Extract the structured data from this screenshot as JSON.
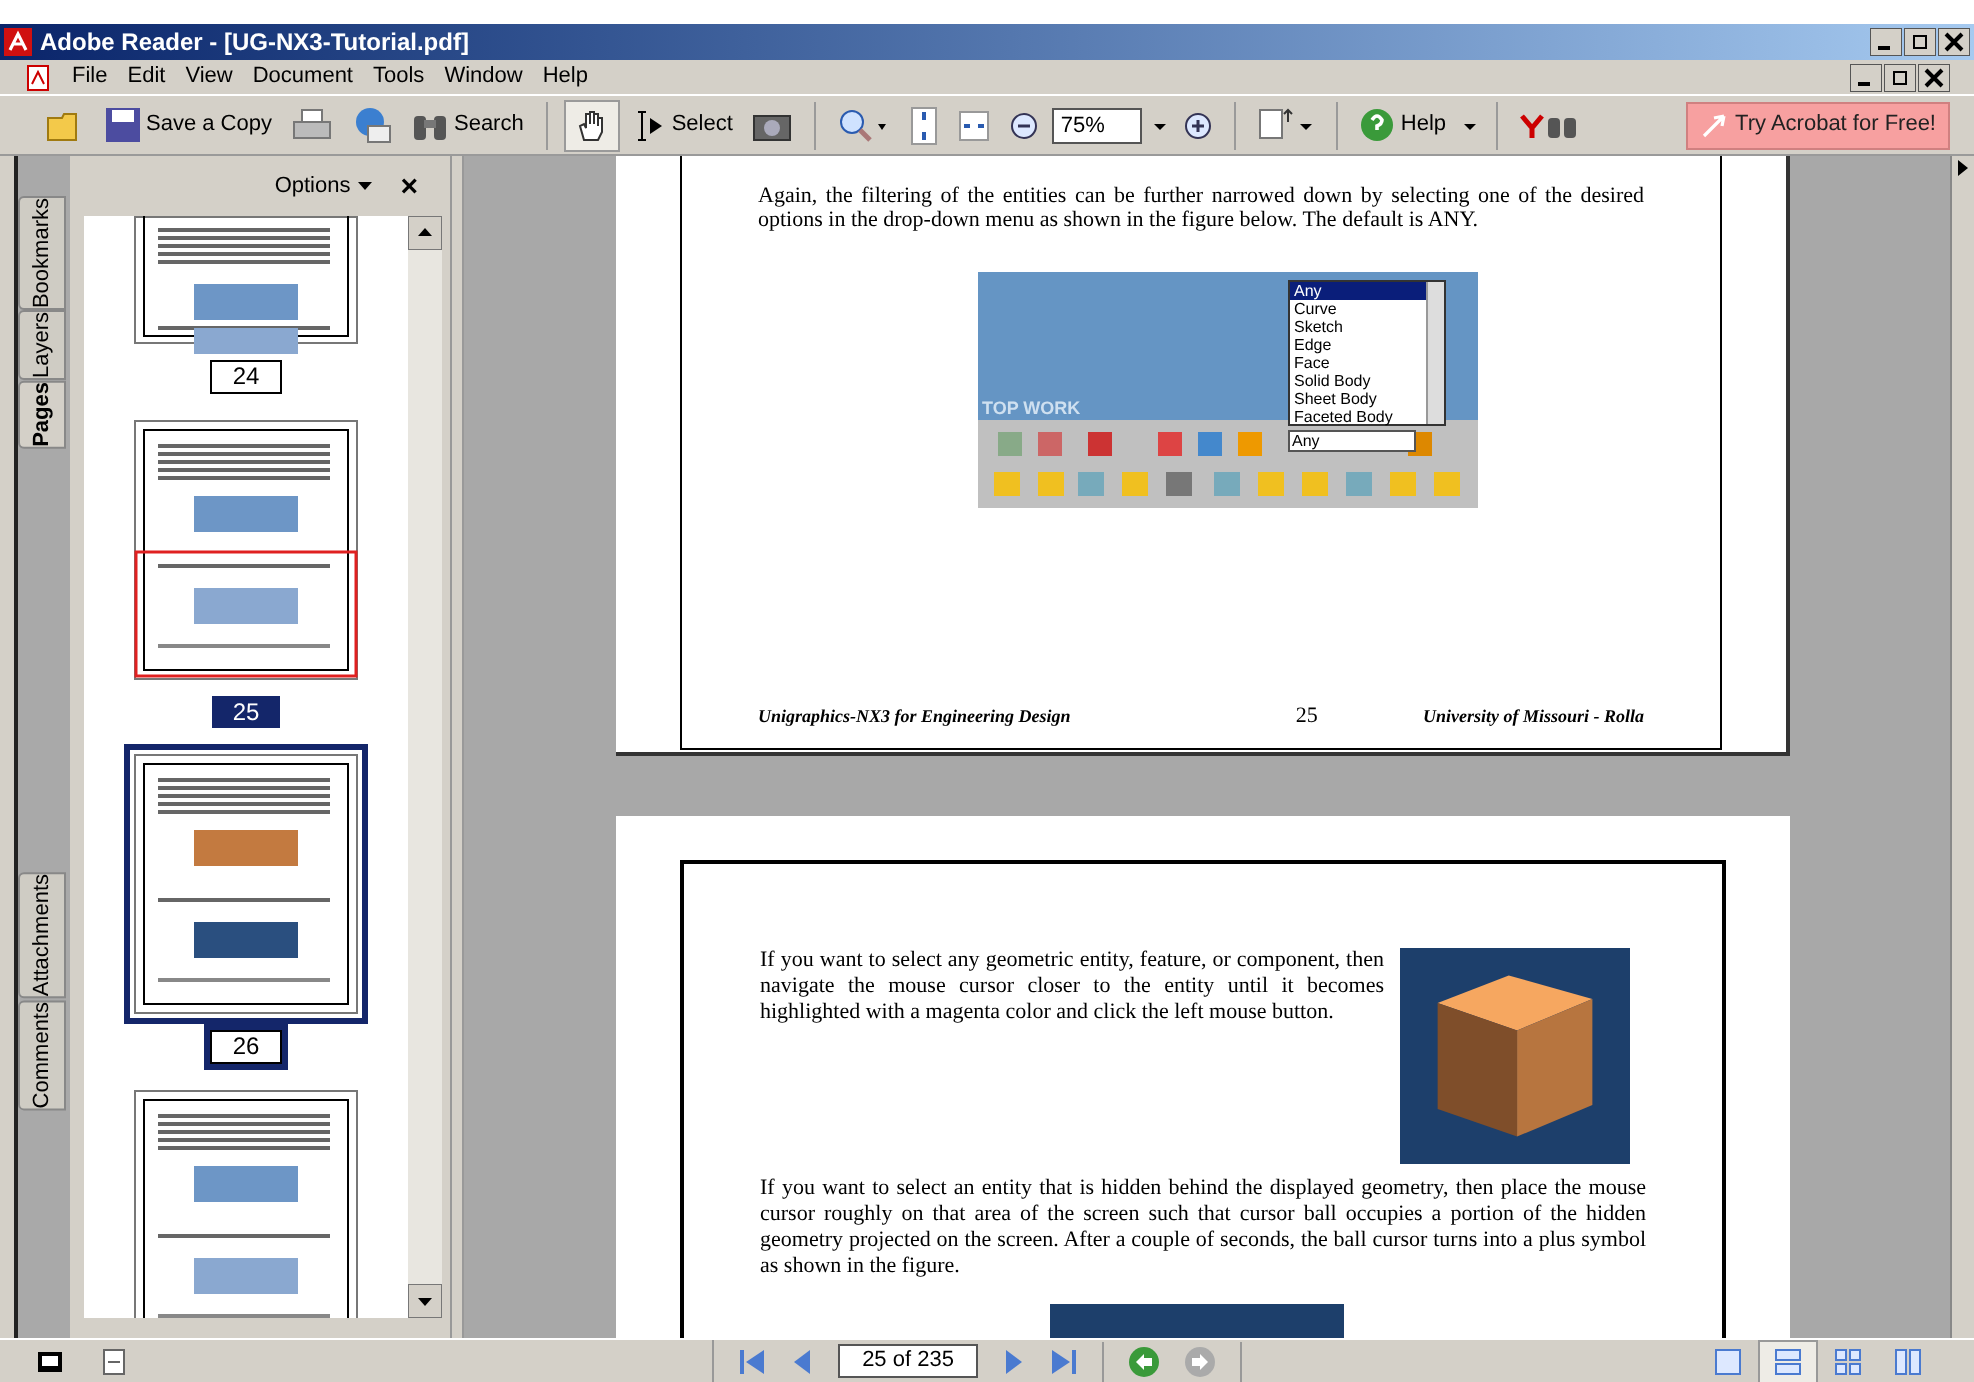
{
  "window": {
    "title": "Adobe Reader - [UG-NX3-Tutorial.pdf]"
  },
  "menu": [
    "File",
    "Edit",
    "View",
    "Document",
    "Tools",
    "Window",
    "Help"
  ],
  "toolbar": {
    "save_copy": "Save a Copy",
    "search": "Search",
    "select": "Select",
    "zoom": "75%",
    "help": "Help",
    "promo": "Try Acrobat for Free!"
  },
  "side_tabs": [
    {
      "label": "Bookmarks",
      "selected": false
    },
    {
      "label": "Layers",
      "selected": false
    },
    {
      "label": "Pages",
      "selected": true
    },
    {
      "label": "Attachments",
      "selected": false
    },
    {
      "label": "Comments",
      "selected": false
    }
  ],
  "panel": {
    "options": "Options",
    "close": "×"
  },
  "thumbnails": [
    {
      "label": "24",
      "current": false,
      "selected": false
    },
    {
      "label": "25",
      "current": true,
      "selected": false
    },
    {
      "label": "26",
      "current": false,
      "selected": true
    },
    {
      "current": false,
      "selected": false
    }
  ],
  "page_1": {
    "paragraph": "Again, the filtering of the entities can be further narrowed down by selecting one of the desired options in the drop-down menu as shown in the figure below. The default is ANY.",
    "figure": {
      "banner": "TOP WORK",
      "list": [
        {
          "label": "Any",
          "selected": true
        },
        {
          "label": "Curve",
          "selected": false
        },
        {
          "label": "Sketch",
          "selected": false
        },
        {
          "label": "Edge",
          "selected": false
        },
        {
          "label": "Face",
          "selected": false
        },
        {
          "label": "Solid Body",
          "selected": false
        },
        {
          "label": "Sheet Body",
          "selected": false
        },
        {
          "label": "Faceted Body",
          "selected": false
        }
      ],
      "combo": "Any"
    },
    "footer": {
      "left": "Unigraphics-NX3 for Engineering Design",
      "center": "25",
      "right": "University of Missouri - Rolla"
    }
  },
  "page_2": {
    "paragraphs": [
      "If you want to select any geometric entity, feature, or component, then navigate the mouse cursor closer to the entity until it becomes highlighted with a magenta color and click the left mouse button.",
      "If you want to select an entity that is hidden behind the displayed geometry, then place the mouse cursor roughly on that area of the screen such that cursor ball occupies a portion of the hidden geometry projected on the screen. After a couple of seconds, the ball cursor turns into a plus symbol as shown in the figure."
    ]
  },
  "status": {
    "page_field": "25 of 235",
    "views": [
      {
        "selected": false
      },
      {
        "selected": true
      },
      {
        "selected": false
      },
      {
        "selected": false
      }
    ]
  }
}
